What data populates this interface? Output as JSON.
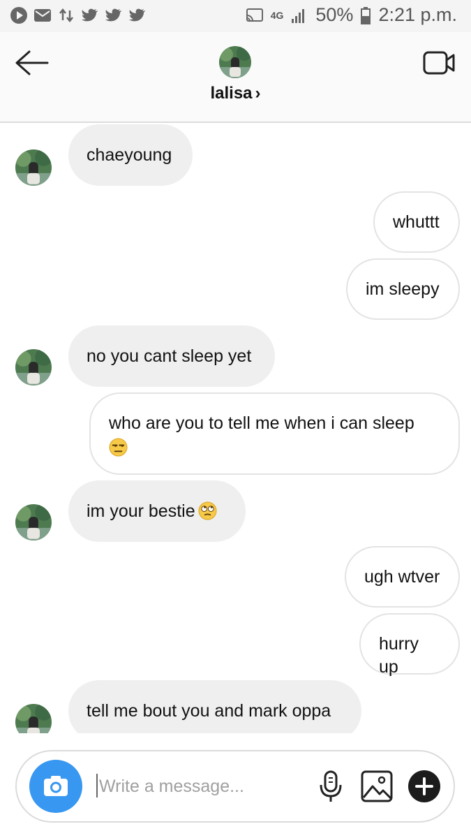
{
  "status_bar": {
    "battery": "50%",
    "time": "2:21 p.m.",
    "network": "4G",
    "icons": [
      "play-icon",
      "mail-icon",
      "transfer-icon",
      "twitter-icon",
      "twitter-icon",
      "twitter-icon",
      "cast-icon",
      "signal-icon",
      "battery-icon"
    ]
  },
  "header": {
    "title": "lalisa",
    "chevron": "›",
    "back_icon": "back-arrow-icon",
    "video_icon": "video-camera-icon"
  },
  "messages": [
    {
      "side": "in",
      "text": "chaeyoung"
    },
    {
      "side": "out",
      "text": "whuttt"
    },
    {
      "side": "out",
      "text": "im sleepy"
    },
    {
      "side": "in",
      "text": "no you cant sleep yet"
    },
    {
      "side": "out",
      "text": "who are you to tell me when i can sleep",
      "emoji": "unamused-face"
    },
    {
      "side": "in",
      "text": "im your bestie",
      "emoji": "rolling-eyes-face"
    },
    {
      "side": "out",
      "text": "ugh wtver"
    },
    {
      "side": "out",
      "text": "hurry up"
    },
    {
      "side": "in",
      "text": "tell me bout you and mark oppa"
    }
  ],
  "composer": {
    "placeholder": "Write a message...",
    "camera_icon": "camera-icon",
    "mic_icon": "microphone-icon",
    "gallery_icon": "image-gallery-icon",
    "add_icon": "plus-icon"
  },
  "colors": {
    "accent": "#3897f0",
    "incoming_bubble": "#efefef",
    "outgoing_border": "#e3e3e3"
  }
}
